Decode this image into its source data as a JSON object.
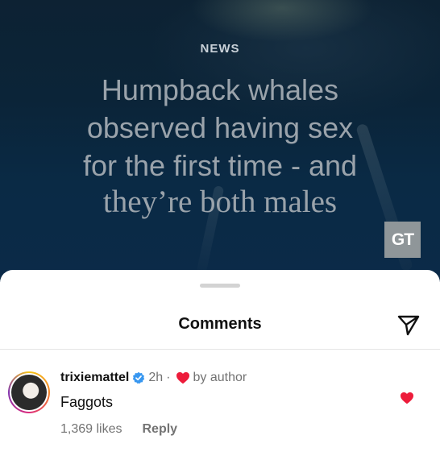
{
  "post": {
    "category": "NEWS",
    "headline_lines_sans": [
      "Humpback whales",
      "observed having sex",
      "for the first time - and"
    ],
    "headline_line_serif": "they’re both males",
    "logo_text": "GT"
  },
  "sheet": {
    "title": "Comments",
    "send_icon": "send-icon"
  },
  "comment": {
    "username": "trixiemattel",
    "verified": true,
    "time": "2h",
    "separator": "·",
    "author_like_label": "by author",
    "text": "Faggots",
    "likes": "1,369 likes",
    "reply_label": "Reply",
    "liked": true
  },
  "colors": {
    "heart": "#ed1c3b",
    "verified": "#3897f0",
    "muted": "#737373"
  }
}
